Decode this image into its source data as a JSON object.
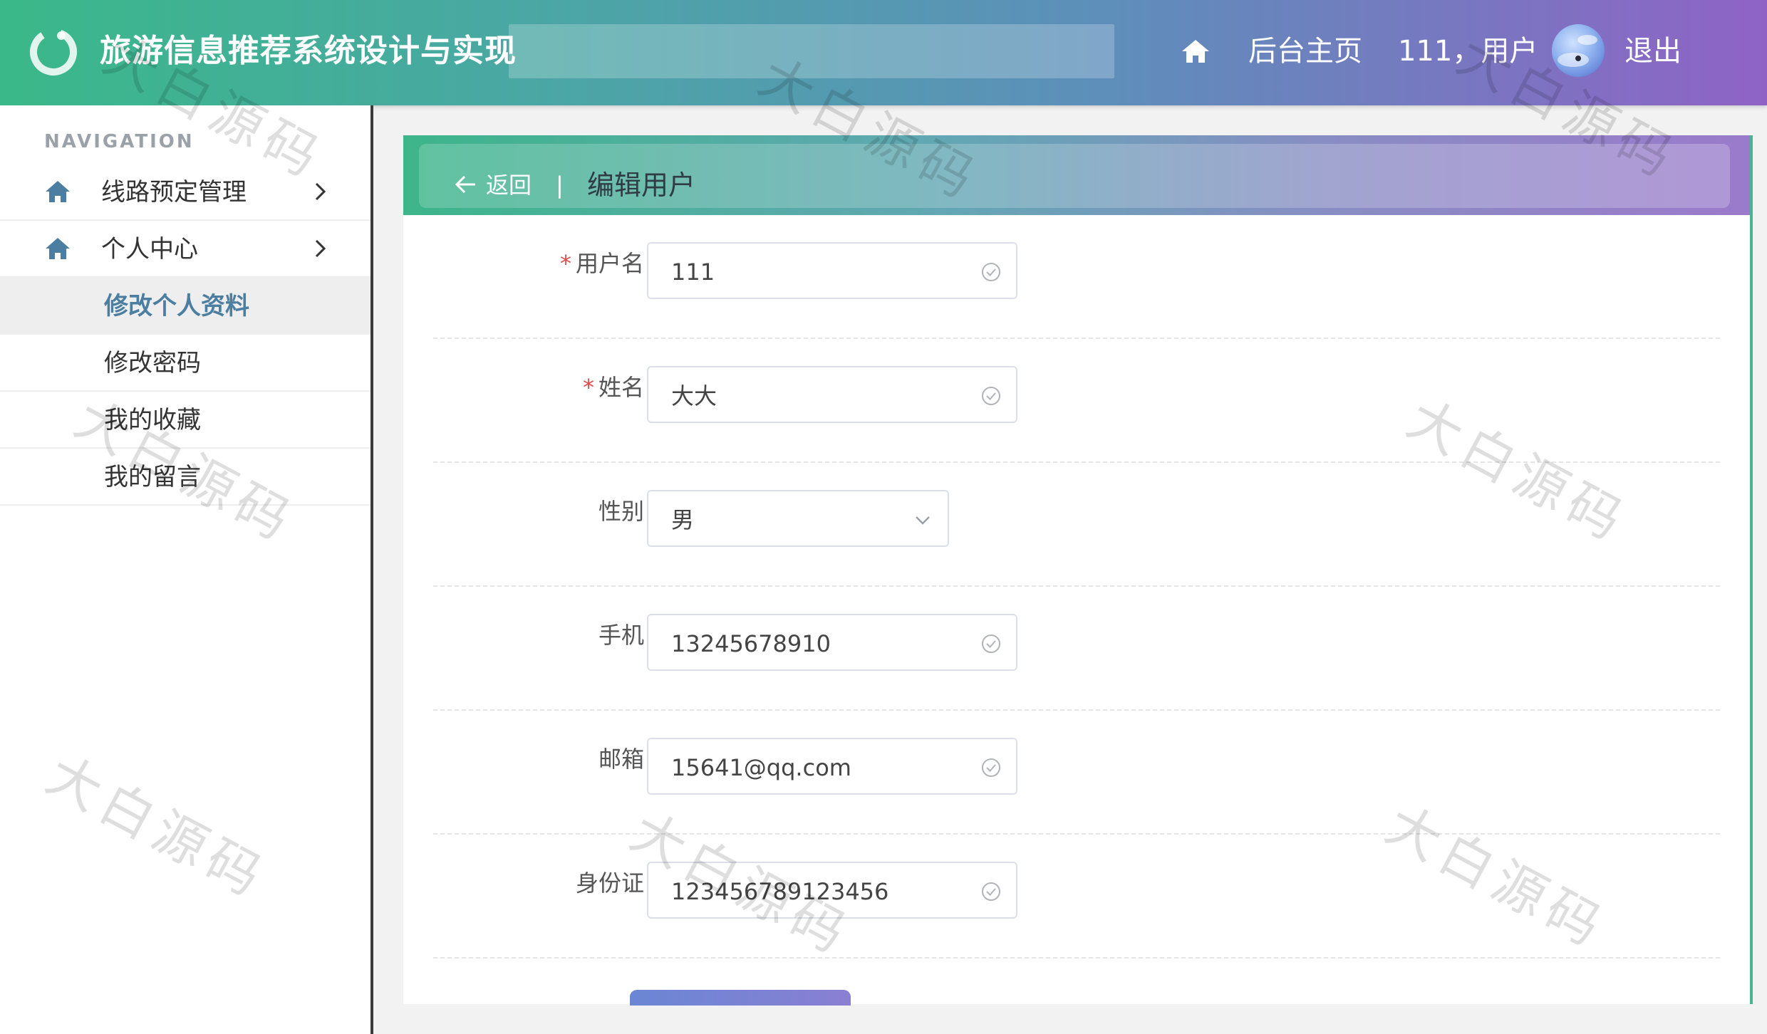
{
  "app": {
    "title": "旅游信息推荐系统设计与实现"
  },
  "topnav": {
    "home_label": "后台主页",
    "user_label": "111，用户",
    "logout_label": "退出"
  },
  "sidebar": {
    "heading": "NAVIGATION",
    "menus": [
      {
        "label": "线路预定管理",
        "icon": "home-icon"
      },
      {
        "label": "个人中心",
        "icon": "home-icon"
      }
    ],
    "submenu": [
      {
        "label": "修改个人资料",
        "active": true
      },
      {
        "label": "修改密码",
        "active": false
      },
      {
        "label": "我的收藏",
        "active": false
      },
      {
        "label": "我的留言",
        "active": false
      }
    ]
  },
  "breadcrumb": {
    "back_label": "返回",
    "divider": "|",
    "title": "编辑用户"
  },
  "form": {
    "fields": [
      {
        "label": "用户名",
        "required": true,
        "value": "111",
        "type": "text"
      },
      {
        "label": "姓名",
        "required": true,
        "value": "大大",
        "type": "text"
      },
      {
        "label": "性别",
        "required": false,
        "value": "男",
        "type": "select"
      },
      {
        "label": "手机",
        "required": false,
        "value": "13245678910",
        "type": "text"
      },
      {
        "label": "邮箱",
        "required": false,
        "value": "15641@qq.com",
        "type": "text"
      },
      {
        "label": "身份证",
        "required": false,
        "value": "123456789123456",
        "type": "text"
      }
    ],
    "required_mark": "*"
  },
  "watermark": {
    "text": "大白源码"
  },
  "colors": {
    "header_start": "#3ab889",
    "header_end": "#8f63c6",
    "accent_icon": "#4b7ea0",
    "required": "#e04b4b"
  }
}
